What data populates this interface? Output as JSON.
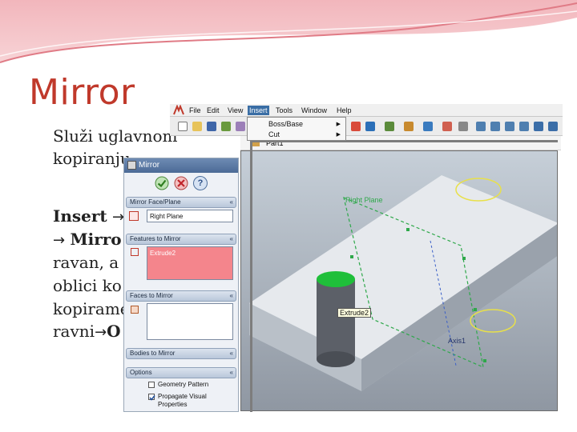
{
  "slide": {
    "title": "Mirror",
    "line1": "Služi uglavnom",
    "line2": "kopiranju",
    "insert_text": "Insert",
    "arrow": "→",
    "mirror_text": "Mirro",
    "line_ravan": "ravan, a t",
    "line_oblici": "oblici ko",
    "line_kopiram": "kopirame",
    "line_ravni": "ravni",
    "ravni_tail": "O"
  },
  "menu": {
    "items": [
      "File",
      "Edit",
      "View",
      "Insert",
      "Tools",
      "Window",
      "Help"
    ],
    "active": "Insert",
    "dropdown": [
      "Boss/Base",
      "Cut"
    ],
    "submenu_glyph": "▶"
  },
  "tree": {
    "node": "Part1"
  },
  "panel": {
    "title": "Mirror",
    "ok_icon": "check-icon",
    "cancel_icon": "x-icon",
    "help_icon": "question-icon",
    "help_glyph": "?",
    "sections": {
      "mirror_face": "Mirror Face/Plane",
      "features": "Features to Mirror",
      "faces": "Faces to Mirror",
      "bodies": "Bodies to Mirror",
      "options": "Options"
    },
    "mirror_plane_value": "Right Plane",
    "feature_value": "Extrude2",
    "option_geometry_pattern": "Geometry Pattern",
    "option_propagate": "Propagate Visual Properties",
    "collapse_glyph": "«"
  },
  "viewport": {
    "plane_label": "Right Plane",
    "feature_tag": "Extrude2",
    "axis_label": "Axis1"
  },
  "colors": {
    "title_red": "#c0392b",
    "swoosh_pink": "#e8a0a8",
    "plane_green": "#2ea84a",
    "selection_pink": "#f4858c",
    "plane_yellow": "#e8e04a"
  }
}
